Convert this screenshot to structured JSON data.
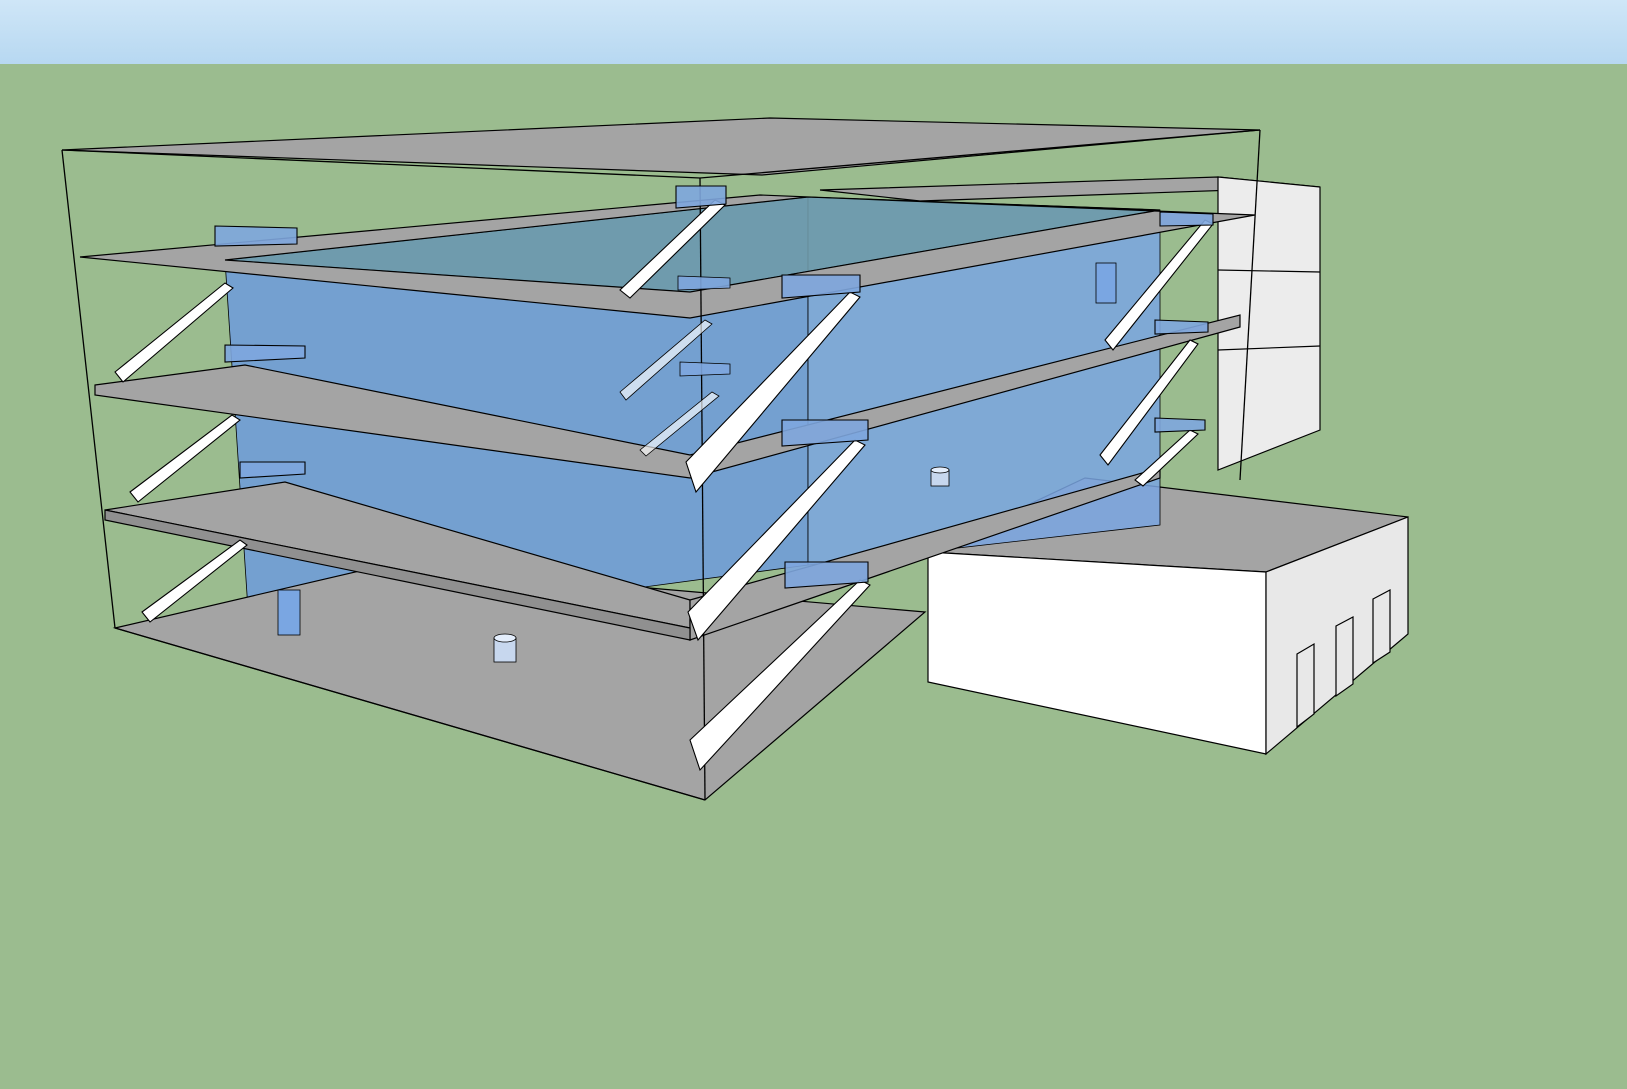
{
  "scene": {
    "type": "3d-model-viewport",
    "colors": {
      "sky_top": "#cfe6f7",
      "sky_bottom": "#b7d8f1",
      "ground": "#9bbc8f",
      "slab": "#a4a4a4",
      "glass": "#6d9bdc",
      "wall_light": "#e8e8e8",
      "wall_white": "#ffffff",
      "edge": "#000000",
      "stair_tread": "#ffffff",
      "landing": "#7ea6de"
    },
    "objects": {
      "floors": 4,
      "main_stair_flights": 4,
      "side_stair_flights": 4,
      "back_stair_flights": 3,
      "annex_doors": 3
    }
  }
}
